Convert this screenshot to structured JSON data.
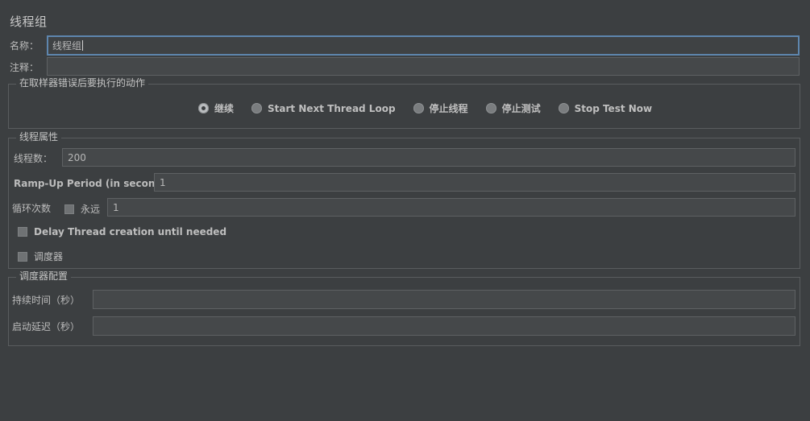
{
  "panel": {
    "title": "线程组"
  },
  "name_row": {
    "label": "名称：",
    "value": "线程组"
  },
  "comments_row": {
    "label": "注释：",
    "value": ""
  },
  "on_error": {
    "group_title": "在取样器错误后要执行的动作",
    "options": [
      {
        "label": "继续",
        "selected": true
      },
      {
        "label": "Start Next Thread Loop",
        "selected": false
      },
      {
        "label": "停止线程",
        "selected": false
      },
      {
        "label": "停止测试",
        "selected": false
      },
      {
        "label": "Stop Test Now",
        "selected": false
      }
    ]
  },
  "thread_properties": {
    "group_title": "线程属性",
    "num_threads_label": "线程数：",
    "num_threads_value": "200",
    "ramp_up_label": "Ramp-Up Period (in seconds):",
    "ramp_up_value": "1",
    "loop_count_label": "循环次数",
    "forever_label": "永远",
    "forever_checked": false,
    "loop_count_value": "1",
    "delay_thread_label": "Delay Thread creation until needed",
    "delay_thread_checked": false,
    "scheduler_label": "调度器",
    "scheduler_checked": false
  },
  "scheduler_config": {
    "group_title": "调度器配置",
    "duration_label": "持续时间（秒）",
    "duration_value": "",
    "startup_delay_label": "启动延迟（秒）",
    "startup_delay_value": ""
  }
}
